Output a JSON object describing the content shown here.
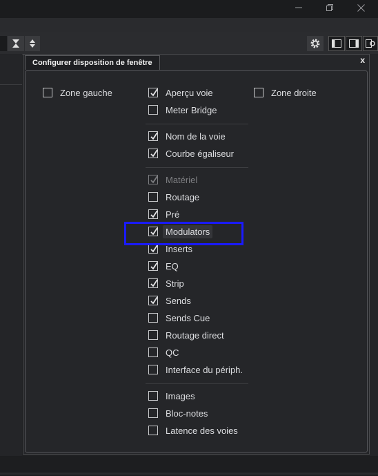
{
  "window": {
    "title": "",
    "minimize_icon": "minimize-icon",
    "restore_icon": "restore-icon",
    "close_icon": "close-icon"
  },
  "toolbar": {
    "icons": [
      "hourglass-icon",
      "up-down-arrows-icon",
      "gear-icon",
      "left-panel-icon",
      "right-panel-icon",
      "panel-settings-icon"
    ]
  },
  "dialog": {
    "title": "Configurer disposition de fenêtre",
    "close_label": "x",
    "left_column": [
      {
        "label": "Zone gauche",
        "checked": false
      }
    ],
    "right_column": [
      {
        "label": "Zone droite",
        "checked": false
      }
    ],
    "middle_groups": [
      [
        {
          "label": "Aperçu voie",
          "checked": true
        },
        {
          "label": "Meter Bridge",
          "checked": false
        }
      ],
      [
        {
          "label": "Nom de la voie",
          "checked": true
        },
        {
          "label": "Courbe égaliseur",
          "checked": true
        }
      ],
      [
        {
          "label": "Matériel",
          "checked": true,
          "disabled": true
        },
        {
          "label": "Routage",
          "checked": false
        },
        {
          "label": "Pré",
          "checked": true
        },
        {
          "label": "Modulators",
          "checked": true,
          "highlighted": true
        },
        {
          "label": "Inserts",
          "checked": true
        },
        {
          "label": "EQ",
          "checked": true
        },
        {
          "label": "Strip",
          "checked": true
        },
        {
          "label": "Sends",
          "checked": true
        },
        {
          "label": "Sends Cue",
          "checked": false
        },
        {
          "label": "Routage direct",
          "checked": false
        },
        {
          "label": "QC",
          "checked": false
        },
        {
          "label": "Interface du périph.",
          "checked": false
        }
      ],
      [
        {
          "label": "Images",
          "checked": false
        },
        {
          "label": "Bloc-notes",
          "checked": false
        },
        {
          "label": "Latence des voies",
          "checked": false
        }
      ]
    ]
  },
  "colors": {
    "background": "#1f2022",
    "dialog_background": "#252629",
    "text": "#dcdde0",
    "annotation_box": "#1a1aff"
  }
}
